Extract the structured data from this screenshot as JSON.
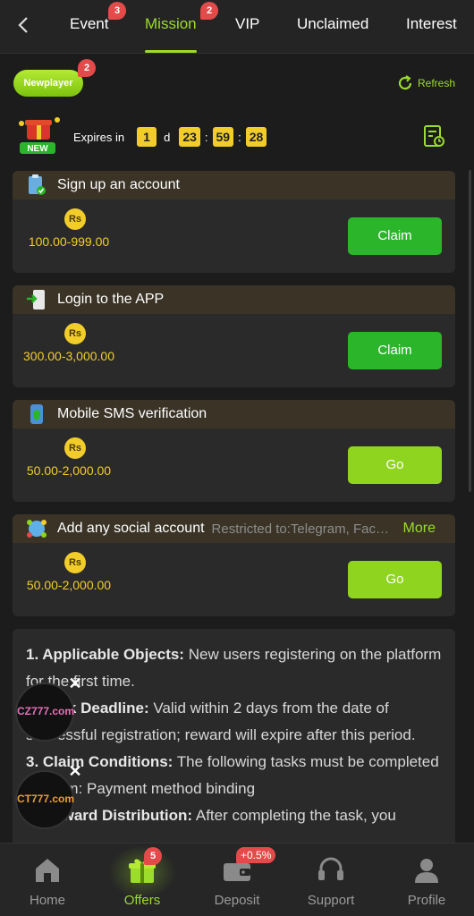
{
  "tabs": [
    {
      "label": "Event",
      "badge": "3"
    },
    {
      "label": "Mission",
      "badge": "2",
      "active": true
    },
    {
      "label": "VIP"
    },
    {
      "label": "Unclaimed"
    },
    {
      "label": "Interest"
    }
  ],
  "filter": {
    "newplayer_label": "Newplayer",
    "newplayer_badge": "2",
    "refresh_label": "Refresh"
  },
  "expires": {
    "label": "Expires in",
    "days": "1",
    "day_unit": "d",
    "hours": "23",
    "minutes": "59",
    "seconds": "28",
    "separator": ":"
  },
  "currency_symbol": "Rs",
  "tasks": [
    {
      "title": "Sign up an account",
      "reward": "100.00-999.00",
      "button": "Claim",
      "icon": "clipboard-check-icon"
    },
    {
      "title": "Login to the APP",
      "reward": "300.00-3,000.00",
      "button": "Claim",
      "icon": "phone-login-icon"
    },
    {
      "title": "Mobile SMS verification",
      "reward": "50.00-2,000.00",
      "button": "Go",
      "icon": "phone-shield-icon"
    },
    {
      "title": "Add any social account",
      "restriction": "Restricted to:Telegram, Facebook",
      "more": "More",
      "reward": "50.00-2,000.00",
      "button": "Go",
      "icon": "social-globe-icon"
    }
  ],
  "rules": [
    {
      "head": "1. Applicable Objects:",
      "text": " New users registering on the platform for the first time."
    },
    {
      "head": "2. Task Deadline:",
      "text": " Valid within 2 days from the date of successful registration; reward will expire after this period."
    },
    {
      "head": "3. Claim Conditions:",
      "text": " The following tasks must be completed to claim: Payment method binding"
    },
    {
      "head": "4. Reward Distribution:",
      "text": " After completing the task, you"
    }
  ],
  "floats": [
    {
      "logo": "CZ777.com",
      "close": "✕"
    },
    {
      "logo": "CT777.com",
      "close": "✕"
    }
  ],
  "nav": [
    {
      "label": "Home",
      "icon": "home-icon"
    },
    {
      "label": "Offers",
      "icon": "gift-icon",
      "badge": "5",
      "active": true
    },
    {
      "label": "Deposit",
      "icon": "wallet-icon",
      "badge": "+0.5%"
    },
    {
      "label": "Support",
      "icon": "headset-icon"
    },
    {
      "label": "Profile",
      "icon": "user-icon"
    }
  ],
  "colors": {
    "accent": "#9bdc2c",
    "gold": "#f2cd2a",
    "claim": "#2bb52a",
    "go": "#8fd41f",
    "badge": "#e34a4a"
  }
}
